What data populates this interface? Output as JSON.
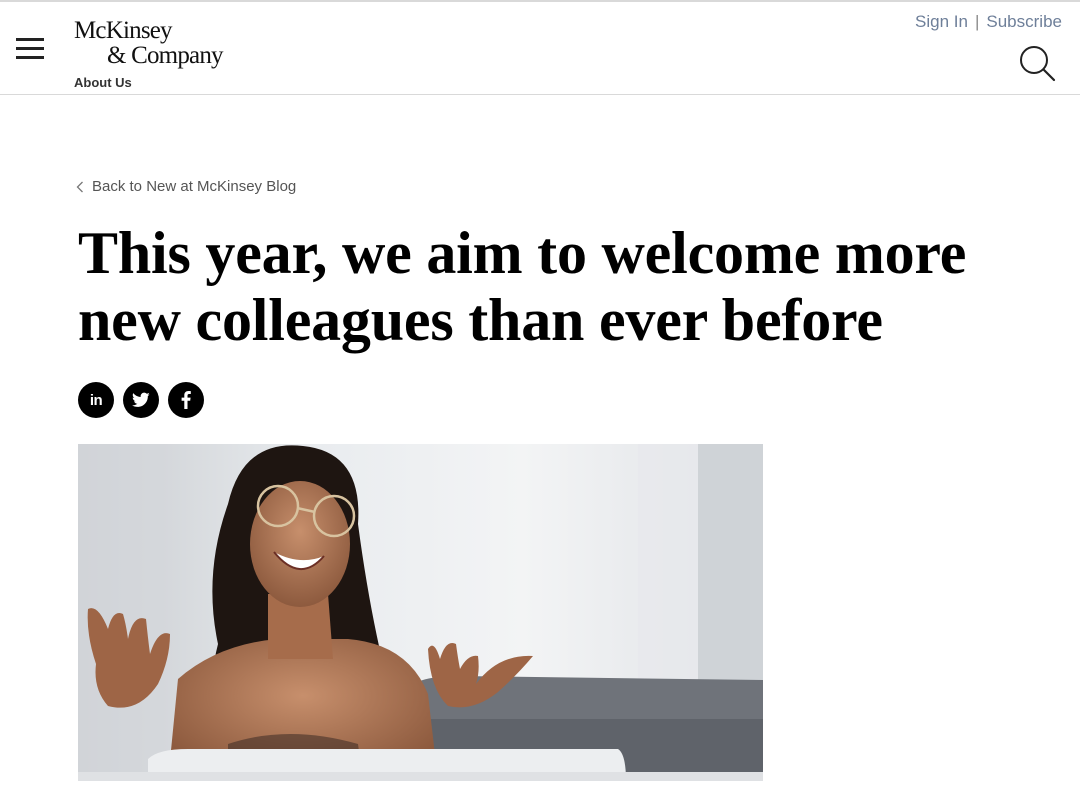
{
  "header": {
    "logo_line1": "McKinsey",
    "logo_line2": "& Company",
    "section_link": "About Us",
    "sign_in": "Sign In",
    "separator": "|",
    "subscribe": "Subscribe",
    "icons": {
      "menu": "hamburger-menu-icon",
      "search": "search-icon"
    }
  },
  "article": {
    "back_link": "Back to New at McKinsey Blog",
    "title": "This year, we aim to welcome more new colleagues than ever before",
    "share": [
      {
        "network": "linkedin",
        "label": "in",
        "icon": "linkedin-icon"
      },
      {
        "network": "twitter",
        "icon": "twitter-icon"
      },
      {
        "network": "facebook",
        "icon": "facebook-icon"
      }
    ],
    "hero_image": "hero-photo-smiling-woman"
  },
  "colors": {
    "account_links": "#6e7f99",
    "title": "#000000",
    "social_bg": "#000000",
    "divider": "#d9d9d9"
  }
}
